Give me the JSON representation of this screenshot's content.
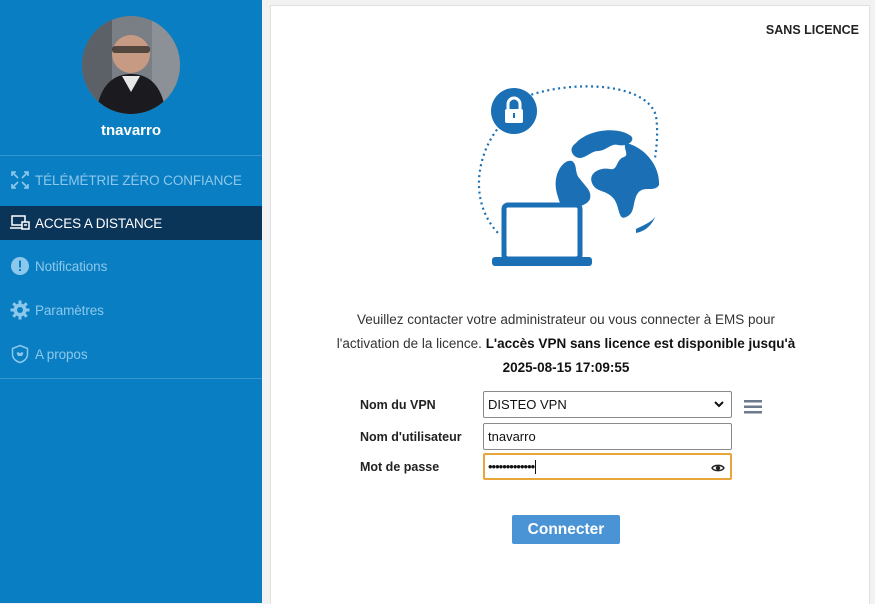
{
  "user": {
    "name": "tnavarro"
  },
  "nav": {
    "items": [
      {
        "label": "TÉLÉMÉTRIE ZÉRO CONFIANCE",
        "icon": "zero-trust-icon",
        "active": false
      },
      {
        "label": "ACCES A DISTANCE",
        "icon": "remote-access-icon",
        "active": true
      },
      {
        "label": "Notifications",
        "icon": "alert-icon",
        "active": false
      },
      {
        "label": "Paramètres",
        "icon": "gear-icon",
        "active": false
      },
      {
        "label": "A propos",
        "icon": "shield-icon",
        "active": false
      }
    ]
  },
  "main": {
    "license_status": "SANS LICENCE",
    "message_part1": "Veuillez contacter votre administrateur ou vous connecter à EMS pour l'activation de la licence.",
    "message_bold": "L'accès VPN sans licence est disponible jusqu'à 2025-08-15 17:09:55"
  },
  "form": {
    "vpn_label": "Nom du VPN",
    "vpn_value": "DISTEO VPN",
    "username_label": "Nom d'utilisateur",
    "username_value": "tnavarro",
    "password_label": "Mot de passe",
    "password_masked": "•••••••••••••",
    "connect_label": "Connecter"
  },
  "colors": {
    "sidebar": "#0a7ec2",
    "active_nav": "#0b3459",
    "accent": "#1a6fb5",
    "button": "#4a94d6",
    "focus_border": "#e8a63a"
  }
}
